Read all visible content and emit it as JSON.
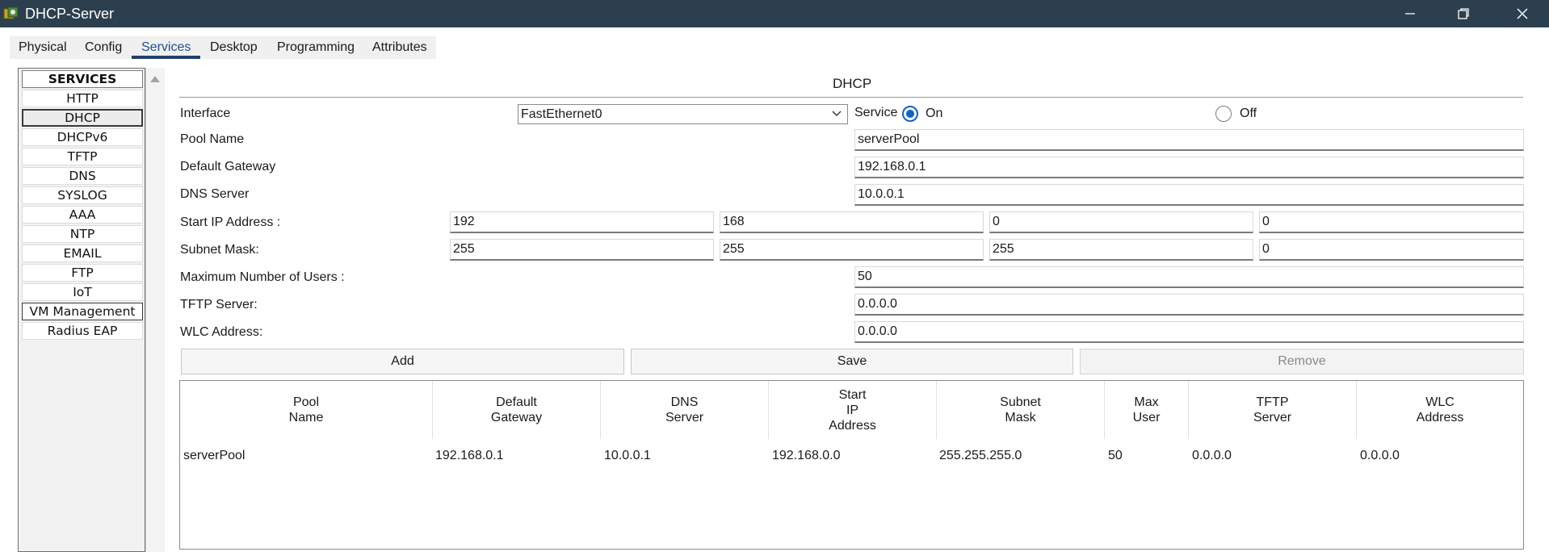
{
  "window": {
    "title": "DHCP-Server",
    "icon": "packet-tracer-icon",
    "controls": [
      "minimize-icon",
      "maximize-icon",
      "close-icon"
    ]
  },
  "tabs": [
    {
      "label": "Physical"
    },
    {
      "label": "Config"
    },
    {
      "label": "Services",
      "active": true
    },
    {
      "label": "Desktop"
    },
    {
      "label": "Programming"
    },
    {
      "label": "Attributes"
    }
  ],
  "sidebar": {
    "header": "SERVICES",
    "items": [
      {
        "label": "HTTP"
      },
      {
        "label": "DHCP",
        "selected": true
      },
      {
        "label": "DHCPv6"
      },
      {
        "label": "TFTP"
      },
      {
        "label": "DNS"
      },
      {
        "label": "SYSLOG"
      },
      {
        "label": "AAA"
      },
      {
        "label": "NTP"
      },
      {
        "label": "EMAIL"
      },
      {
        "label": "FTP"
      },
      {
        "label": "IoT"
      },
      {
        "label": "VM Management"
      },
      {
        "label": "Radius EAP"
      }
    ]
  },
  "dhcp": {
    "title": "DHCP",
    "interface_label": "Interface",
    "interface_value": "FastEthernet0",
    "service_label": "Service",
    "service_on_label": "On",
    "service_off_label": "Off",
    "service_state": "On",
    "pool_name_label": "Pool Name",
    "pool_name_value": "serverPool",
    "default_gateway_label": "Default Gateway",
    "default_gateway_value": "192.168.0.1",
    "dns_server_label": "DNS Server",
    "dns_server_value": "10.0.0.1",
    "start_ip_label": "Start IP Address :",
    "start_ip_octets": [
      "192",
      "168",
      "0",
      "0"
    ],
    "subnet_mask_label": "Subnet Mask:",
    "subnet_mask_octets": [
      "255",
      "255",
      "255",
      "0"
    ],
    "max_users_label": "Maximum Number of Users :",
    "max_users_value": "50",
    "tftp_server_label": "TFTP Server:",
    "tftp_server_value": "0.0.0.0",
    "wlc_address_label": "WLC Address:",
    "wlc_address_value": "0.0.0.0",
    "buttons": {
      "add": "Add",
      "save": "Save",
      "remove": "Remove"
    }
  },
  "pool_table": {
    "columns": [
      [
        "Pool",
        "Name"
      ],
      [
        "Default",
        "Gateway"
      ],
      [
        "DNS",
        "Server"
      ],
      [
        "Start",
        "IP",
        "Address"
      ],
      [
        "Subnet",
        "Mask"
      ],
      [
        "Max",
        "User"
      ],
      [
        "TFTP",
        "Server"
      ],
      [
        "WLC",
        "Address"
      ]
    ],
    "rows": [
      [
        "serverPool",
        "192.168.0.1",
        "10.0.0.1",
        "192.168.0.0",
        "255.255.255.0",
        "50",
        "0.0.0.0",
        "0.0.0.0"
      ]
    ]
  }
}
